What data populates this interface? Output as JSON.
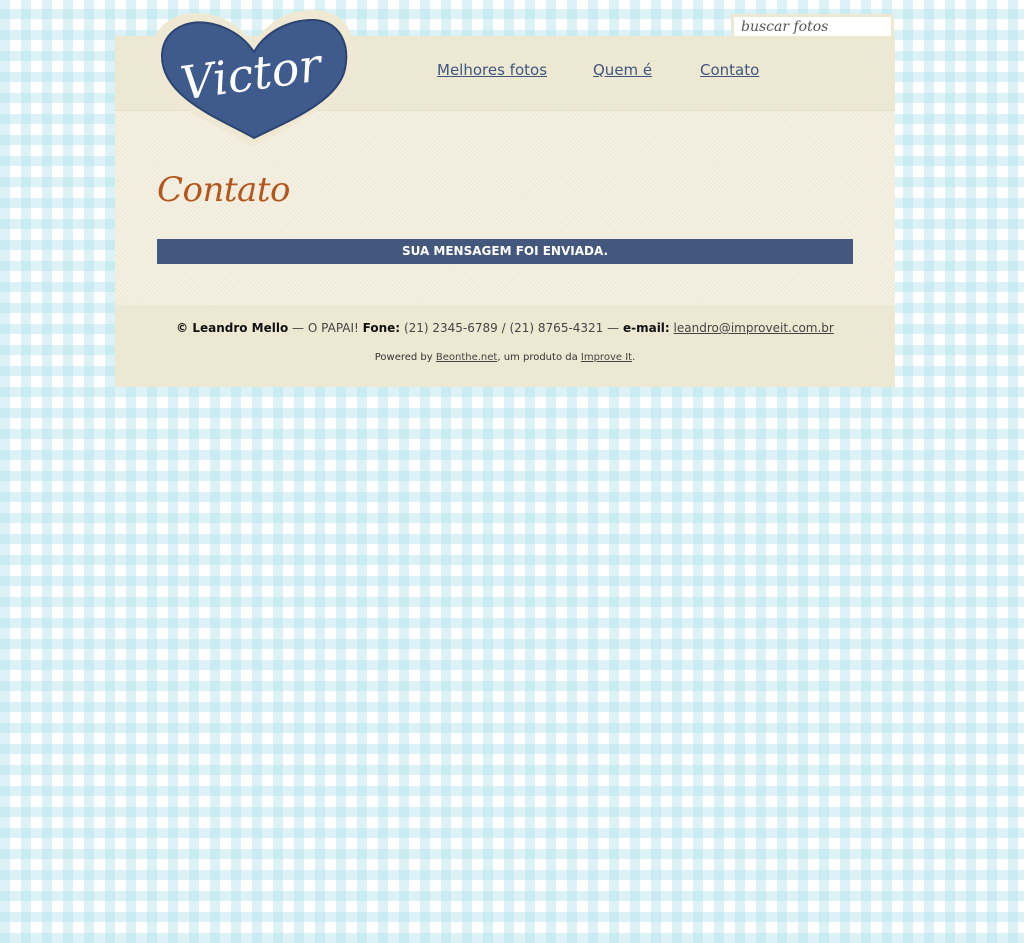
{
  "search": {
    "placeholder": "buscar fotos"
  },
  "logo": {
    "text": "Victor",
    "shape": "heart",
    "color": "#3f5a8c"
  },
  "nav": {
    "items": [
      {
        "label": "Melhores fotos"
      },
      {
        "label": "Quem é"
      },
      {
        "label": "Contato"
      }
    ]
  },
  "main": {
    "title": "Contato",
    "alert": "SUA MENSAGEM FOI ENVIADA."
  },
  "footer": {
    "copyright": "© Leandro Mello",
    "dash1": " — ",
    "tagline": "O PAPAI!",
    "phone_label": "Fone:",
    "phones": "(21) 2345-6789 / (21) 8765-4321",
    "dash2": " — ",
    "email_label": "e-mail:",
    "email": "leandro@improveit.com.br",
    "powered_prefix": "Powered by ",
    "powered_link": "Beonthe.net",
    "powered_middle": ", um produto da ",
    "company_link": "Improve It",
    "powered_suffix": "."
  },
  "colors": {
    "accent_blue": "#44577d",
    "title_orange": "#b5561d",
    "panel_beige": "#ede8d2",
    "background_check": "#b2e2ec"
  }
}
